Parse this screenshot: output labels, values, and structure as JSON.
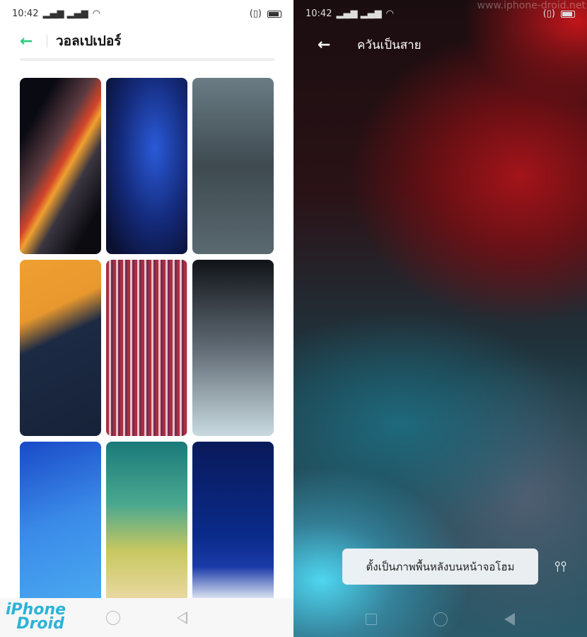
{
  "left": {
    "status": {
      "time": "10:42"
    },
    "header": {
      "title": "วอลเปเปอร์"
    },
    "wallpapers": [
      "wallpaper-light-streaks",
      "wallpaper-blue-swirl",
      "wallpaper-forest",
      "wallpaper-desert-dune",
      "wallpaper-red-glitch",
      "wallpaper-gray-glitch",
      "wallpaper-blue-waves",
      "wallpaper-beach-aerial",
      "wallpaper-mountain-night"
    ],
    "logo": "iPhone Droid"
  },
  "right": {
    "status": {
      "time": "10:42"
    },
    "watermark": "www.iphone-droid.net",
    "header": {
      "title": "ควันเป็นสาย"
    },
    "set_button": "ตั้งเป็นภาพพื้นหลังบนหน้าจอโฮม",
    "accent": "#2ecc82"
  }
}
